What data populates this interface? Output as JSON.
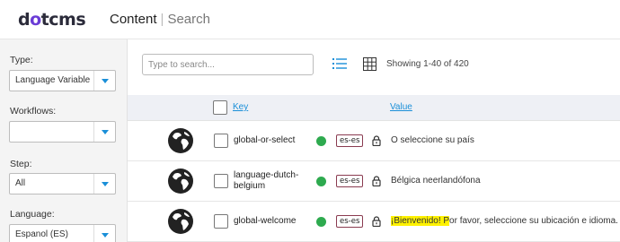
{
  "header": {
    "logo_prefix": "d",
    "logo_dot": "o",
    "logo_suffix": "tcms",
    "title": "Content",
    "separator": "|",
    "section": "Search"
  },
  "sidebar": {
    "type_label": "Type:",
    "type_value": "Language Variable",
    "workflows_label": "Workflows:",
    "workflows_value": "",
    "step_label": "Step:",
    "step_value": "All",
    "language_label": "Language:",
    "language_value": "Espanol (ES)"
  },
  "toolbar": {
    "search_placeholder": "Type to search...",
    "list_view_icon": "list-icon",
    "grid_view_icon": "grid-icon",
    "showing": "Showing 1-40 of 420"
  },
  "table": {
    "columns": {
      "key": "Key",
      "value": "Value"
    },
    "rows": [
      {
        "key": "global-or-select",
        "lang": "es-es",
        "value": "O seleccione su país",
        "status_color": "#2eaa4f"
      },
      {
        "key": "language-dutch-\nbelgium",
        "lang": "es-es",
        "value": "Bélgica neerlandófona",
        "status_color": "#2eaa4f"
      },
      {
        "key": "global-welcome",
        "lang": "es-es",
        "value_highlight_a": "¡Bienvenido! P",
        "value_rest": "or favor, seleccione su ubicación e idioma.",
        "status_color": "#2eaa4f"
      }
    ]
  },
  "colors": {
    "accent": "#1a8fd8",
    "highlight": "#fff200",
    "brand": "#6a3cd6"
  }
}
